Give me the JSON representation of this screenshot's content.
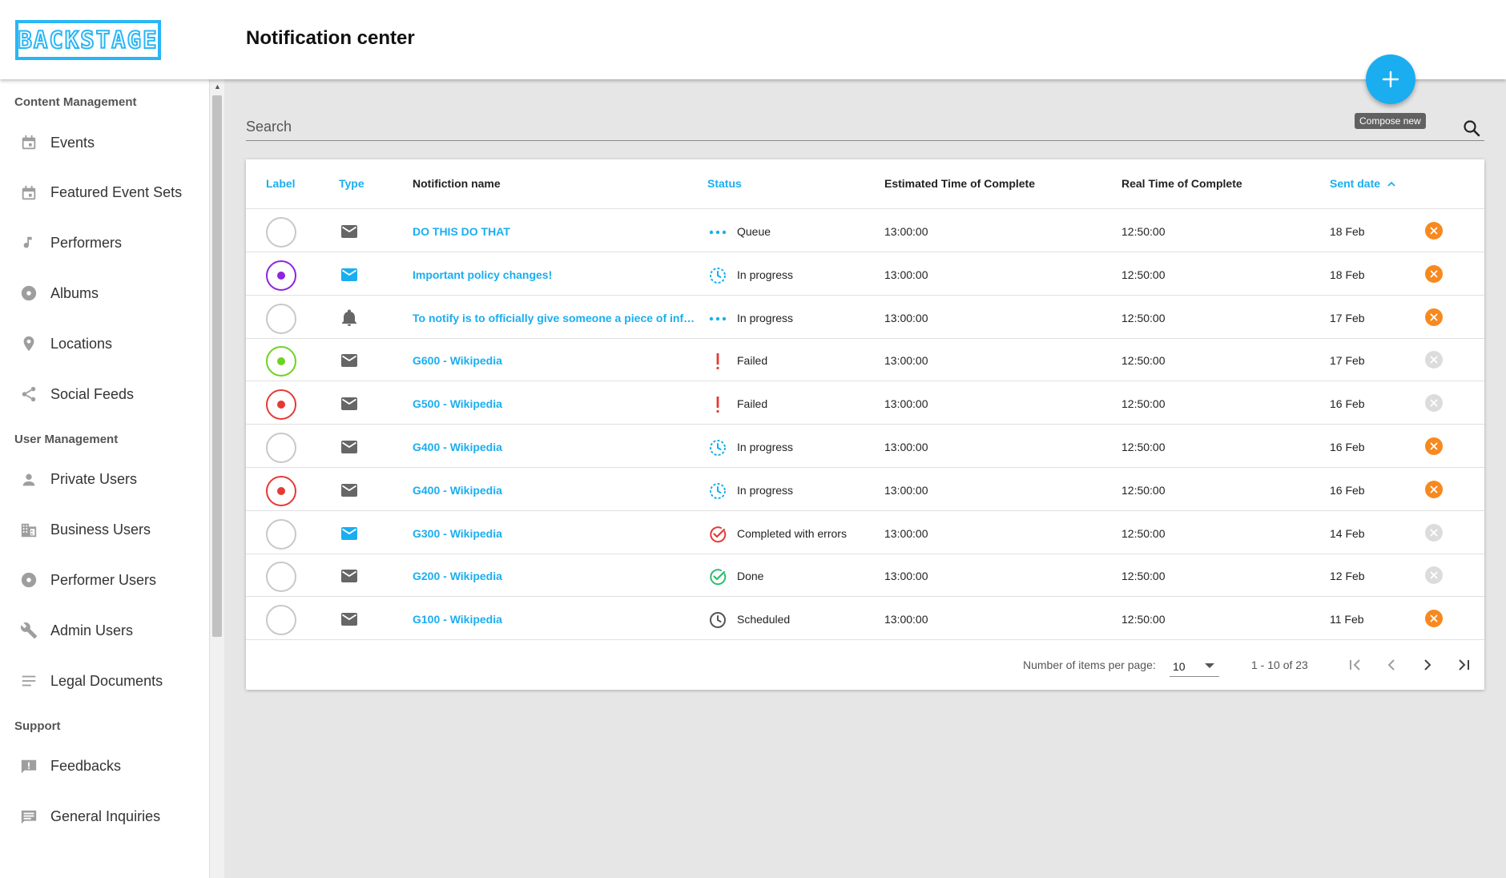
{
  "app": {
    "logo_text": "BACKSTAGE",
    "page_title": "Notification center"
  },
  "colors": {
    "accent": "#1aaef0",
    "cancel_active": "#f7891f",
    "failed": "#e53935",
    "done": "#2bbf6e"
  },
  "sidebar": {
    "sections": [
      {
        "title": "Content Management",
        "items": [
          {
            "label": "Events",
            "icon": "calendar-icon"
          },
          {
            "label": "Featured Event Sets",
            "icon": "calendar-icon"
          },
          {
            "label": "Performers",
            "icon": "music-note-icon"
          },
          {
            "label": "Albums",
            "icon": "album-icon"
          },
          {
            "label": "Locations",
            "icon": "location-pin-icon"
          },
          {
            "label": "Social Feeds",
            "icon": "share-icon"
          }
        ]
      },
      {
        "title": "User Management",
        "items": [
          {
            "label": "Private Users",
            "icon": "person-icon"
          },
          {
            "label": "Business Users",
            "icon": "building-icon"
          },
          {
            "label": "Performer Users",
            "icon": "album-icon"
          },
          {
            "label": "Admin Users",
            "icon": "wrench-icon"
          },
          {
            "label": "Legal Documents",
            "icon": "lines-icon"
          }
        ]
      },
      {
        "title": "Support",
        "items": [
          {
            "label": "Feedbacks",
            "icon": "feedback-icon"
          },
          {
            "label": "General Inquiries",
            "icon": "chat-icon"
          }
        ]
      }
    ]
  },
  "compose": {
    "icon": "plus-icon",
    "tooltip": "Compose new"
  },
  "search": {
    "placeholder": "Search",
    "value": ""
  },
  "table": {
    "columns": {
      "label": "Label",
      "type": "Type",
      "name": "Notifiction name",
      "status": "Status",
      "estimated": "Estimated Time of Complete",
      "real": "Real Time of Complete",
      "sent": "Sent date"
    },
    "rows": [
      {
        "label": "none",
        "type": "mail",
        "type_color": "#666666",
        "name": "DO THIS DO THAT",
        "status_icon": "dots",
        "status": "Queue",
        "est": "13:00:00",
        "real": "12:50:00",
        "sent": "18 Feb",
        "cancellable": true
      },
      {
        "label": "purple",
        "type": "mail",
        "type_color": "#1aaef0",
        "name": "Important policy changes!",
        "status_icon": "progress",
        "status": "In progress",
        "est": "13:00:00",
        "real": "12:50:00",
        "sent": "18 Feb",
        "cancellable": true
      },
      {
        "label": "none",
        "type": "bell",
        "type_color": "#666666",
        "name": "To notify is to officially give someone a piece of information",
        "status_icon": "dots",
        "status": "In progress",
        "est": "13:00:00",
        "real": "12:50:00",
        "sent": "17 Feb",
        "cancellable": true
      },
      {
        "label": "green",
        "type": "mail",
        "type_color": "#666666",
        "name": "G600 - Wikipedia",
        "status_icon": "failed",
        "status": "Failed",
        "est": "13:00:00",
        "real": "12:50:00",
        "sent": "17 Feb",
        "cancellable": false
      },
      {
        "label": "red",
        "type": "mail",
        "type_color": "#666666",
        "name": "G500 - Wikipedia",
        "status_icon": "failed",
        "status": "Failed",
        "est": "13:00:00",
        "real": "12:50:00",
        "sent": "16 Feb",
        "cancellable": false
      },
      {
        "label": "none",
        "type": "mail",
        "type_color": "#666666",
        "name": "G400 - Wikipedia",
        "status_icon": "progress",
        "status": "In progress",
        "est": "13:00:00",
        "real": "12:50:00",
        "sent": "16 Feb",
        "cancellable": true
      },
      {
        "label": "red",
        "type": "mail",
        "type_color": "#666666",
        "name": "G400 - Wikipedia",
        "status_icon": "progress",
        "status": "In progress",
        "est": "13:00:00",
        "real": "12:50:00",
        "sent": "16 Feb",
        "cancellable": true
      },
      {
        "label": "none",
        "type": "mail",
        "type_color": "#1aaef0",
        "name": "G300 - Wikipedia",
        "status_icon": "errors",
        "status": "Completed with errors",
        "est": "13:00:00",
        "real": "12:50:00",
        "sent": "14 Feb",
        "cancellable": false
      },
      {
        "label": "none",
        "type": "mail",
        "type_color": "#666666",
        "name": "G200 - Wikipedia",
        "status_icon": "done",
        "status": "Done",
        "est": "13:00:00",
        "real": "12:50:00",
        "sent": "12 Feb",
        "cancellable": false
      },
      {
        "label": "none",
        "type": "mail",
        "type_color": "#666666",
        "name": "G100 - Wikipedia",
        "status_icon": "scheduled",
        "status": "Scheduled",
        "est": "13:00:00",
        "real": "12:50:00",
        "sent": "11 Feb",
        "cancellable": true
      }
    ]
  },
  "pagination": {
    "items_per_page_label": "Number of items per page:",
    "items_per_page": "10",
    "range": "1 - 10 of 23"
  }
}
